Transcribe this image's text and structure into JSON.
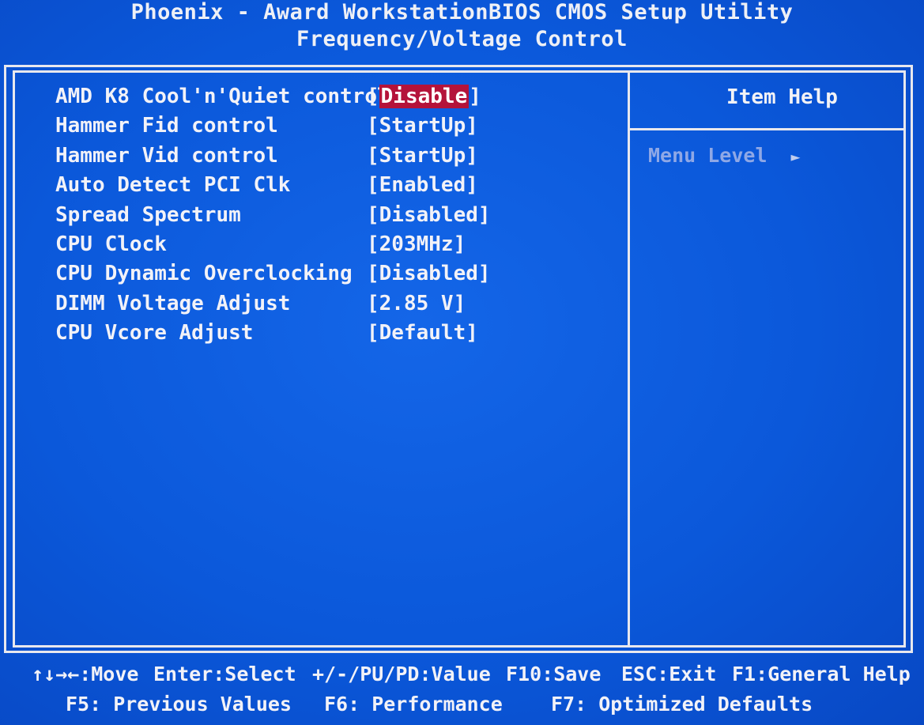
{
  "header": {
    "title": "Phoenix - Award WorkstationBIOS CMOS Setup Utility",
    "subtitle": "Frequency/Voltage Control"
  },
  "settings": [
    {
      "label": "AMD K8 Cool'n'Quiet control",
      "value": "Disable",
      "selected": true
    },
    {
      "label": "Hammer Fid control",
      "value": "StartUp",
      "selected": false
    },
    {
      "label": "Hammer Vid control",
      "value": "StartUp",
      "selected": false
    },
    {
      "label": "Auto Detect PCI Clk",
      "value": "Enabled",
      "selected": false
    },
    {
      "label": "Spread Spectrum",
      "value": "Disabled",
      "selected": false
    },
    {
      "label": "CPU Clock",
      "value": "203MHz",
      "selected": false
    },
    {
      "label": "CPU Dynamic Overclocking",
      "value": "Disabled",
      "selected": false
    },
    {
      "label": "DIMM Voltage Adjust",
      "value": "2.85 V",
      "selected": false
    },
    {
      "label": "CPU Vcore Adjust",
      "value": "Default",
      "selected": false
    }
  ],
  "help_panel": {
    "title": "Item Help",
    "menu_level_label": "Menu Level",
    "arrow_icon": "►"
  },
  "footer": {
    "line1": [
      "↑↓→←:Move",
      "Enter:Select",
      "+/-/PU/PD:Value",
      "F10:Save",
      "ESC:Exit",
      "F1:General Help"
    ],
    "line2": [
      "F5: Previous Values",
      "F6: Performance",
      "F7: Optimized Defaults"
    ]
  },
  "colors": {
    "background": "#0a55d6",
    "text": "#f2f2f8",
    "highlight": "#b4133a",
    "help_dim_text": "#8fa8e6"
  }
}
